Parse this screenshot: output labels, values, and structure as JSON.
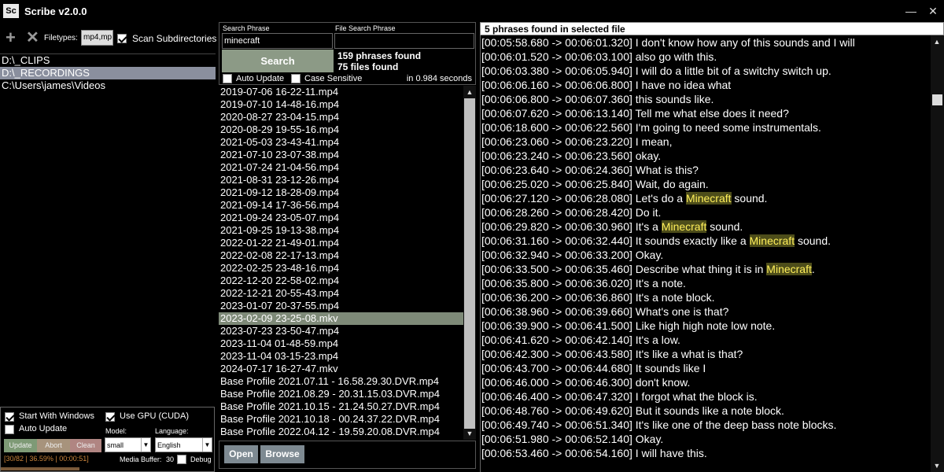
{
  "app": {
    "logo": "Sc",
    "title": "Scribe v2.0.0",
    "minimize_glyph": "—",
    "close_glyph": "✕"
  },
  "left": {
    "add_icon": "plus-icon",
    "remove_icon": "close-icon",
    "filetypes_label": "Filetypes:",
    "filetypes_value": "mp4,mp",
    "scan_subdirs_label": "Scan Subdirectories",
    "scan_subdirs_checked": true,
    "directories": [
      {
        "path": "D:\\_CLIPS",
        "selected": false
      },
      {
        "path": "D:\\_RECORDINGS",
        "selected": true
      },
      {
        "path": "C:\\Users\\james\\Videos",
        "selected": false
      }
    ],
    "settings": {
      "start_with_windows_label": "Start With Windows",
      "start_with_windows_checked": true,
      "use_gpu_label": "Use GPU (CUDA)",
      "use_gpu_checked": true,
      "auto_update_label": "Auto Update",
      "auto_update_checked": false,
      "update_label": "Update",
      "abort_label": "Abort",
      "clean_label": "Clean",
      "model_label": "Model:",
      "model_value": "small",
      "language_label": "Language:",
      "language_value": "English",
      "media_buffer_label": "Media Buffer:",
      "media_buffer_value": "30",
      "debug_label": "Debug",
      "status_line": "[30/82 | 36.59% | 00:00:51]",
      "progress_fraction": 0.3659
    }
  },
  "middle": {
    "search_phrase_label": "Search Phrase",
    "file_search_phrase_label": "File Search Phrase",
    "search_value": "minecraft",
    "file_search_value": "",
    "search_button": "Search",
    "phrases_found": "159 phrases found",
    "files_found": "75 files found",
    "auto_update_label": "Auto Update",
    "case_sensitive_label": "Case Sensitive",
    "time_text": "in 0.984 seconds",
    "files": [
      {
        "name": "2019-07-06 16-22-11.mp4",
        "selected": false
      },
      {
        "name": "2019-07-10 14-48-16.mp4",
        "selected": false
      },
      {
        "name": "2020-08-27 23-04-15.mp4",
        "selected": false
      },
      {
        "name": "2020-08-29 19-55-16.mp4",
        "selected": false
      },
      {
        "name": "2021-05-03 23-43-41.mp4",
        "selected": false
      },
      {
        "name": "2021-07-10 23-07-38.mp4",
        "selected": false
      },
      {
        "name": "2021-07-24 21-04-56.mp4",
        "selected": false
      },
      {
        "name": "2021-08-31 23-12-26.mp4",
        "selected": false
      },
      {
        "name": "2021-09-12 18-28-09.mp4",
        "selected": false
      },
      {
        "name": "2021-09-14 17-36-56.mp4",
        "selected": false
      },
      {
        "name": "2021-09-24 23-05-07.mp4",
        "selected": false
      },
      {
        "name": "2021-09-25 19-13-38.mp4",
        "selected": false
      },
      {
        "name": "2022-01-22 21-49-01.mp4",
        "selected": false
      },
      {
        "name": "2022-02-08 22-17-13.mp4",
        "selected": false
      },
      {
        "name": "2022-02-25 23-48-16.mp4",
        "selected": false
      },
      {
        "name": "2022-12-20 22-58-02.mp4",
        "selected": false
      },
      {
        "name": "2022-12-21 20-55-43.mp4",
        "selected": false
      },
      {
        "name": "2023-01-07 20-37-55.mp4",
        "selected": false
      },
      {
        "name": "2023-02-09 23-25-08.mkv",
        "selected": true
      },
      {
        "name": "2023-07-23 23-50-47.mp4",
        "selected": false
      },
      {
        "name": "2023-11-04 01-48-59.mp4",
        "selected": false
      },
      {
        "name": "2023-11-04 03-15-23.mp4",
        "selected": false
      },
      {
        "name": "2024-07-17 16-27-47.mkv",
        "selected": false
      },
      {
        "name": "Base Profile 2021.07.11 - 16.58.29.30.DVR.mp4",
        "selected": false
      },
      {
        "name": "Base Profile 2021.08.29 - 20.31.15.03.DVR.mp4",
        "selected": false
      },
      {
        "name": "Base Profile 2021.10.15 - 21.24.50.27.DVR.mp4",
        "selected": false
      },
      {
        "name": "Base Profile 2021.10.18 - 00.24.37.22.DVR.mp4",
        "selected": false
      },
      {
        "name": "Base Profile 2022.04.12 - 19.59.20.08.DVR.mp4",
        "selected": false
      }
    ],
    "open_button": "Open",
    "browse_button": "Browse"
  },
  "right": {
    "header": "5 phrases found in selected file",
    "lines": [
      {
        "pre": "[00:05:58.680 -> 00:06:01.320] I don't know how any of this sounds and I will",
        "hl": "",
        "post": ""
      },
      {
        "pre": "[00:06:01.520 -> 00:06:03.100] also go with this.",
        "hl": "",
        "post": ""
      },
      {
        "pre": "[00:06:03.380 -> 00:06:05.940] I will do a little bit of a switchy switch up.",
        "hl": "",
        "post": ""
      },
      {
        "pre": "[00:06:06.160 -> 00:06:06.800] I have no idea what",
        "hl": "",
        "post": ""
      },
      {
        "pre": "[00:06:06.800 -> 00:06:07.360] this sounds like.",
        "hl": "",
        "post": ""
      },
      {
        "pre": "[00:06:07.620 -> 00:06:13.140] Tell me what else does it need?",
        "hl": "",
        "post": ""
      },
      {
        "pre": "[00:06:18.600 -> 00:06:22.560] I'm going to need some instrumentals.",
        "hl": "",
        "post": ""
      },
      {
        "pre": "[00:06:23.060 -> 00:06:23.220] I mean,",
        "hl": "",
        "post": ""
      },
      {
        "pre": "[00:06:23.240 -> 00:06:23.560] okay.",
        "hl": "",
        "post": ""
      },
      {
        "pre": "[00:06:23.640 -> 00:06:24.360] What is this?",
        "hl": "",
        "post": ""
      },
      {
        "pre": "[00:06:25.020 -> 00:06:25.840] Wait, do again.",
        "hl": "",
        "post": ""
      },
      {
        "pre": "[00:06:27.120 -> 00:06:28.080] Let's do a ",
        "hl": "Minecraft",
        "post": " sound."
      },
      {
        "pre": "[00:06:28.260 -> 00:06:28.420] Do it.",
        "hl": "",
        "post": ""
      },
      {
        "pre": "[00:06:29.820 -> 00:06:30.960] It's a ",
        "hl": "Minecraft",
        "post": " sound."
      },
      {
        "pre": "[00:06:31.160 -> 00:06:32.440] It sounds exactly like a ",
        "hl": "Minecraft",
        "post": " sound."
      },
      {
        "pre": "[00:06:32.940 -> 00:06:33.200] Okay.",
        "hl": "",
        "post": ""
      },
      {
        "pre": "[00:06:33.500 -> 00:06:35.460] Describe what thing it is in ",
        "hl": "Minecraft",
        "post": "."
      },
      {
        "pre": "[00:06:35.800 -> 00:06:36.020] It's a note.",
        "hl": "",
        "post": ""
      },
      {
        "pre": "[00:06:36.200 -> 00:06:36.860] It's a note block.",
        "hl": "",
        "post": ""
      },
      {
        "pre": "[00:06:38.960 -> 00:06:39.660] What's one is that?",
        "hl": "",
        "post": ""
      },
      {
        "pre": "[00:06:39.900 -> 00:06:41.500] Like high high note low note.",
        "hl": "",
        "post": ""
      },
      {
        "pre": "[00:06:41.620 -> 00:06:42.140] It's a low.",
        "hl": "",
        "post": ""
      },
      {
        "pre": "[00:06:42.300 -> 00:06:43.580] It's like a what is that?",
        "hl": "",
        "post": ""
      },
      {
        "pre": "[00:06:43.700 -> 00:06:44.680] It sounds like I",
        "hl": "",
        "post": ""
      },
      {
        "pre": "[00:06:46.000 -> 00:06:46.300] don't know.",
        "hl": "",
        "post": ""
      },
      {
        "pre": "[00:06:46.400 -> 00:06:47.320] I forgot what the block is.",
        "hl": "",
        "post": ""
      },
      {
        "pre": "[00:06:48.760 -> 00:06:49.620] But it sounds like a note block.",
        "hl": "",
        "post": ""
      },
      {
        "pre": "[00:06:49.740 -> 00:06:51.340] It's like one of the deep bass note blocks.",
        "hl": "",
        "post": ""
      },
      {
        "pre": "[00:06:51.980 -> 00:06:52.140] Okay.",
        "hl": "",
        "post": ""
      },
      {
        "pre": "[00:06:53.460 -> 00:06:54.160] I will have this.",
        "hl": "",
        "post": ""
      }
    ]
  }
}
